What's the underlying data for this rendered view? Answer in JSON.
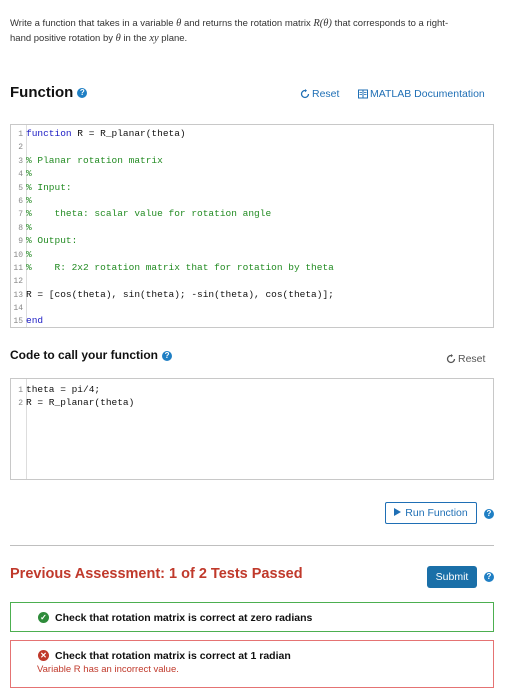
{
  "prompt": {
    "line1_a": "Write a function that takes in a variable ",
    "theta": "θ",
    "line1_b": " and returns the rotation matrix ",
    "matrix": "R(θ)",
    "line1_c": " that corresponds to a right-",
    "line2_a": "hand positive rotation by ",
    "line2_b": " in the ",
    "plane": "xy",
    "line2_c": " plane."
  },
  "function_section": {
    "title": "Function",
    "reset_label": "Reset",
    "doc_label": "MATLAB Documentation",
    "lines": [
      {
        "n": "1",
        "kw": "function",
        "text": " R = R_planar(theta)",
        "comment": ""
      },
      {
        "n": "2",
        "kw": "",
        "text": "",
        "comment": ""
      },
      {
        "n": "3",
        "kw": "",
        "text": "",
        "comment": "% Planar rotation matrix"
      },
      {
        "n": "4",
        "kw": "",
        "text": "",
        "comment": "%"
      },
      {
        "n": "5",
        "kw": "",
        "text": "",
        "comment": "% Input:"
      },
      {
        "n": "6",
        "kw": "",
        "text": "",
        "comment": "%"
      },
      {
        "n": "7",
        "kw": "",
        "text": "",
        "comment": "%    theta: scalar value for rotation angle"
      },
      {
        "n": "8",
        "kw": "",
        "text": "",
        "comment": "%"
      },
      {
        "n": "9",
        "kw": "",
        "text": "",
        "comment": "% Output:"
      },
      {
        "n": "10",
        "kw": "",
        "text": "",
        "comment": "%"
      },
      {
        "n": "11",
        "kw": "",
        "text": "",
        "comment": "%    R: 2x2 rotation matrix that for rotation by theta"
      },
      {
        "n": "12",
        "kw": "",
        "text": "",
        "comment": ""
      },
      {
        "n": "13",
        "kw": "",
        "text": "R = [cos(theta), sin(theta); -sin(theta), cos(theta)];",
        "comment": ""
      },
      {
        "n": "14",
        "kw": "",
        "text": "",
        "comment": ""
      },
      {
        "n": "15",
        "kw": "end",
        "text": "",
        "comment": ""
      }
    ]
  },
  "call_section": {
    "title": "Code to call your function",
    "reset_label": "Reset",
    "lines": [
      {
        "n": "1",
        "text": "theta = pi/4;"
      },
      {
        "n": "2",
        "text": "R = R_planar(theta)"
      }
    ]
  },
  "run_button_label": "Run Function",
  "assessment": {
    "title": "Previous Assessment: 1 of 2 Tests Passed",
    "submit_label": "Submit",
    "tests": [
      {
        "label": "Check that rotation matrix is correct at zero radians",
        "status": "pass",
        "message": ""
      },
      {
        "label": "Check that rotation matrix is correct at 1 radian",
        "status": "fail",
        "message": "Variable R has an incorrect value."
      }
    ]
  },
  "colors": {
    "accent": "#1f6fb5",
    "pass": "#2e8b3a",
    "fail": "#c0392b"
  }
}
